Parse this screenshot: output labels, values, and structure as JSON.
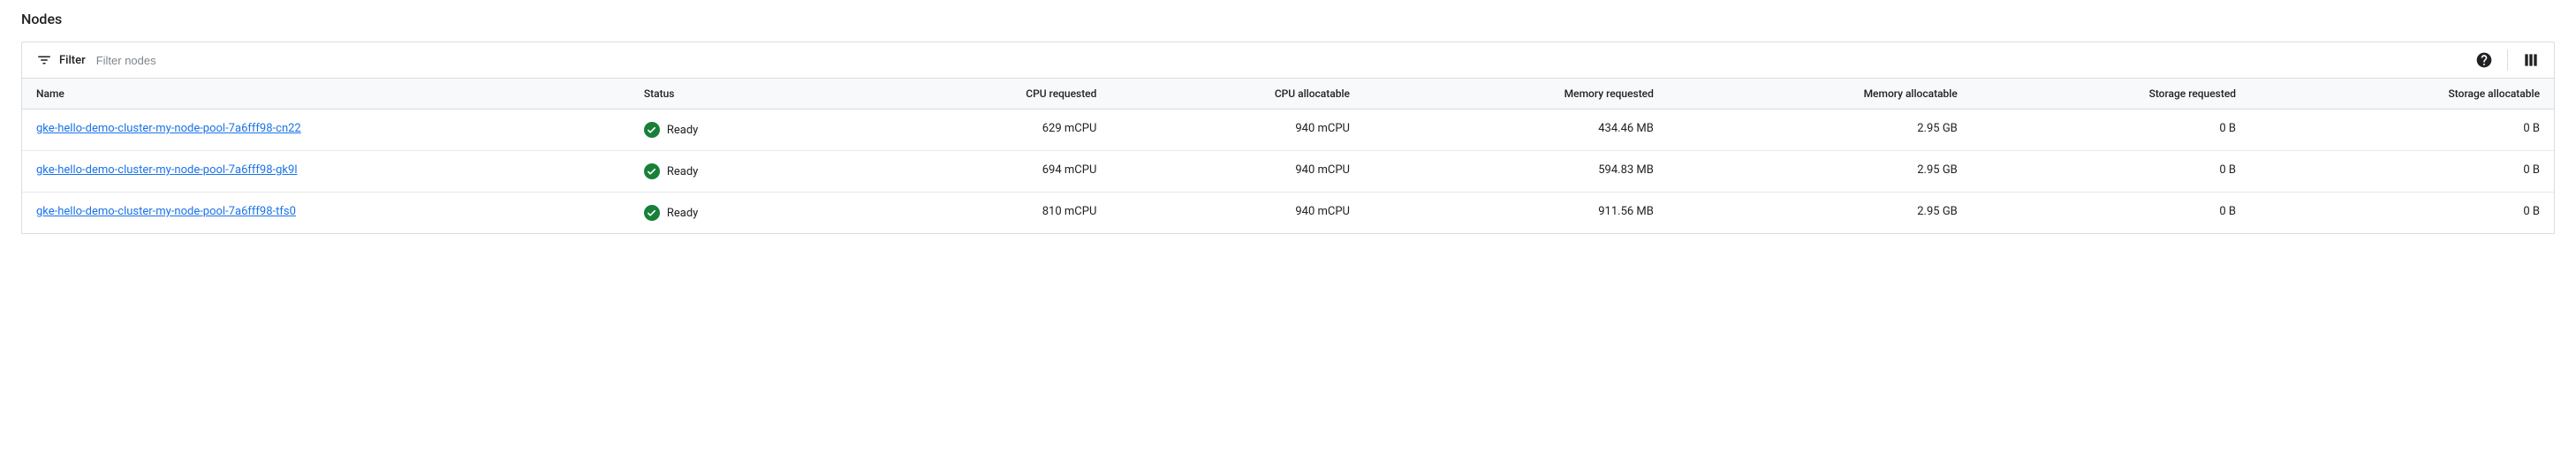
{
  "section_title": "Nodes",
  "filter": {
    "label": "Filter",
    "placeholder": "Filter nodes"
  },
  "columns": {
    "name": "Name",
    "status": "Status",
    "cpu_requested": "CPU requested",
    "cpu_allocatable": "CPU allocatable",
    "memory_requested": "Memory requested",
    "memory_allocatable": "Memory allocatable",
    "storage_requested": "Storage requested",
    "storage_allocatable": "Storage allocatable"
  },
  "rows": [
    {
      "name": "gke-hello-demo-cluster-my-node-pool-7a6fff98-cn22",
      "status": "Ready",
      "cpu_requested": "629 mCPU",
      "cpu_allocatable": "940 mCPU",
      "memory_requested": "434.46 MB",
      "memory_allocatable": "2.95 GB",
      "storage_requested": "0 B",
      "storage_allocatable": "0 B"
    },
    {
      "name": "gke-hello-demo-cluster-my-node-pool-7a6fff98-gk9l",
      "status": "Ready",
      "cpu_requested": "694 mCPU",
      "cpu_allocatable": "940 mCPU",
      "memory_requested": "594.83 MB",
      "memory_allocatable": "2.95 GB",
      "storage_requested": "0 B",
      "storage_allocatable": "0 B"
    },
    {
      "name": "gke-hello-demo-cluster-my-node-pool-7a6fff98-tfs0",
      "status": "Ready",
      "cpu_requested": "810 mCPU",
      "cpu_allocatable": "940 mCPU",
      "memory_requested": "911.56 MB",
      "memory_allocatable": "2.95 GB",
      "storage_requested": "0 B",
      "storage_allocatable": "0 B"
    }
  ]
}
